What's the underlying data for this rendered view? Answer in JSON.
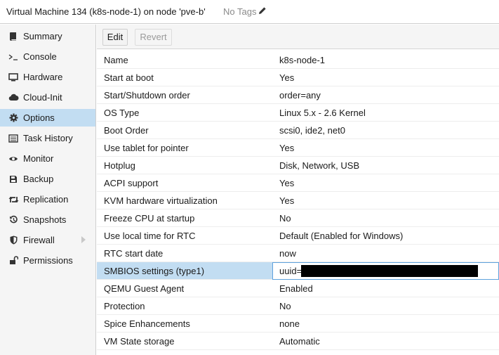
{
  "header": {
    "title": "Virtual Machine 134 (k8s-node-1) on node 'pve-b'",
    "tags_label": "No Tags"
  },
  "sidebar": {
    "items": [
      {
        "label": "Summary",
        "icon": "book-icon"
      },
      {
        "label": "Console",
        "icon": "terminal-icon"
      },
      {
        "label": "Hardware",
        "icon": "monitor-icon"
      },
      {
        "label": "Cloud-Init",
        "icon": "cloud-icon"
      },
      {
        "label": "Options",
        "icon": "gear-icon",
        "active": true
      },
      {
        "label": "Task History",
        "icon": "list-icon"
      },
      {
        "label": "Monitor",
        "icon": "eye-icon"
      },
      {
        "label": "Backup",
        "icon": "floppy-icon"
      },
      {
        "label": "Replication",
        "icon": "retweet-icon"
      },
      {
        "label": "Snapshots",
        "icon": "history-icon"
      },
      {
        "label": "Firewall",
        "icon": "shield-icon",
        "expandable": true
      },
      {
        "label": "Permissions",
        "icon": "unlock-icon"
      }
    ]
  },
  "toolbar": {
    "edit_label": "Edit",
    "revert_label": "Revert"
  },
  "options": {
    "rows": [
      {
        "key": "Name",
        "value": "k8s-node-1"
      },
      {
        "key": "Start at boot",
        "value": "Yes"
      },
      {
        "key": "Start/Shutdown order",
        "value": "order=any"
      },
      {
        "key": "OS Type",
        "value": "Linux 5.x - 2.6 Kernel"
      },
      {
        "key": "Boot Order",
        "value": "scsi0, ide2, net0"
      },
      {
        "key": "Use tablet for pointer",
        "value": "Yes"
      },
      {
        "key": "Hotplug",
        "value": "Disk, Network, USB"
      },
      {
        "key": "ACPI support",
        "value": "Yes"
      },
      {
        "key": "KVM hardware virtualization",
        "value": "Yes"
      },
      {
        "key": "Freeze CPU at startup",
        "value": "No"
      },
      {
        "key": "Use local time for RTC",
        "value": "Default (Enabled for Windows)"
      },
      {
        "key": "RTC start date",
        "value": "now"
      },
      {
        "key": "SMBIOS settings (type1)",
        "value": "uuid=",
        "selected": true
      },
      {
        "key": "QEMU Guest Agent",
        "value": "Enabled"
      },
      {
        "key": "Protection",
        "value": "No"
      },
      {
        "key": "Spice Enhancements",
        "value": "none"
      },
      {
        "key": "VM State storage",
        "value": "Automatic"
      }
    ]
  },
  "colors": {
    "selection": "#c2ddf2",
    "selection_border": "#5fa2dd",
    "sidebar_bg": "#f5f5f5"
  }
}
